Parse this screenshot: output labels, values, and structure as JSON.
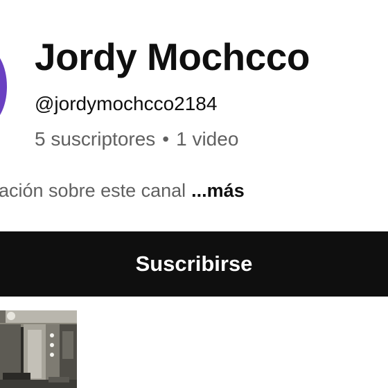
{
  "channel": {
    "name": "Jordy Mochcco",
    "handle": "@jordymochcco2184",
    "subscribers": "5 suscriptores",
    "separator": "•",
    "videos": "1 video",
    "description_fragment": "ación sobre este canal",
    "more_label": "...más",
    "avatar_color": "#6a40c2"
  },
  "actions": {
    "subscribe_label": "Suscribirse"
  },
  "colors": {
    "primary_text": "#0f0f0f",
    "secondary_text": "#606060",
    "subscribe_bg": "#0f0f0f",
    "subscribe_text": "#ffffff"
  }
}
